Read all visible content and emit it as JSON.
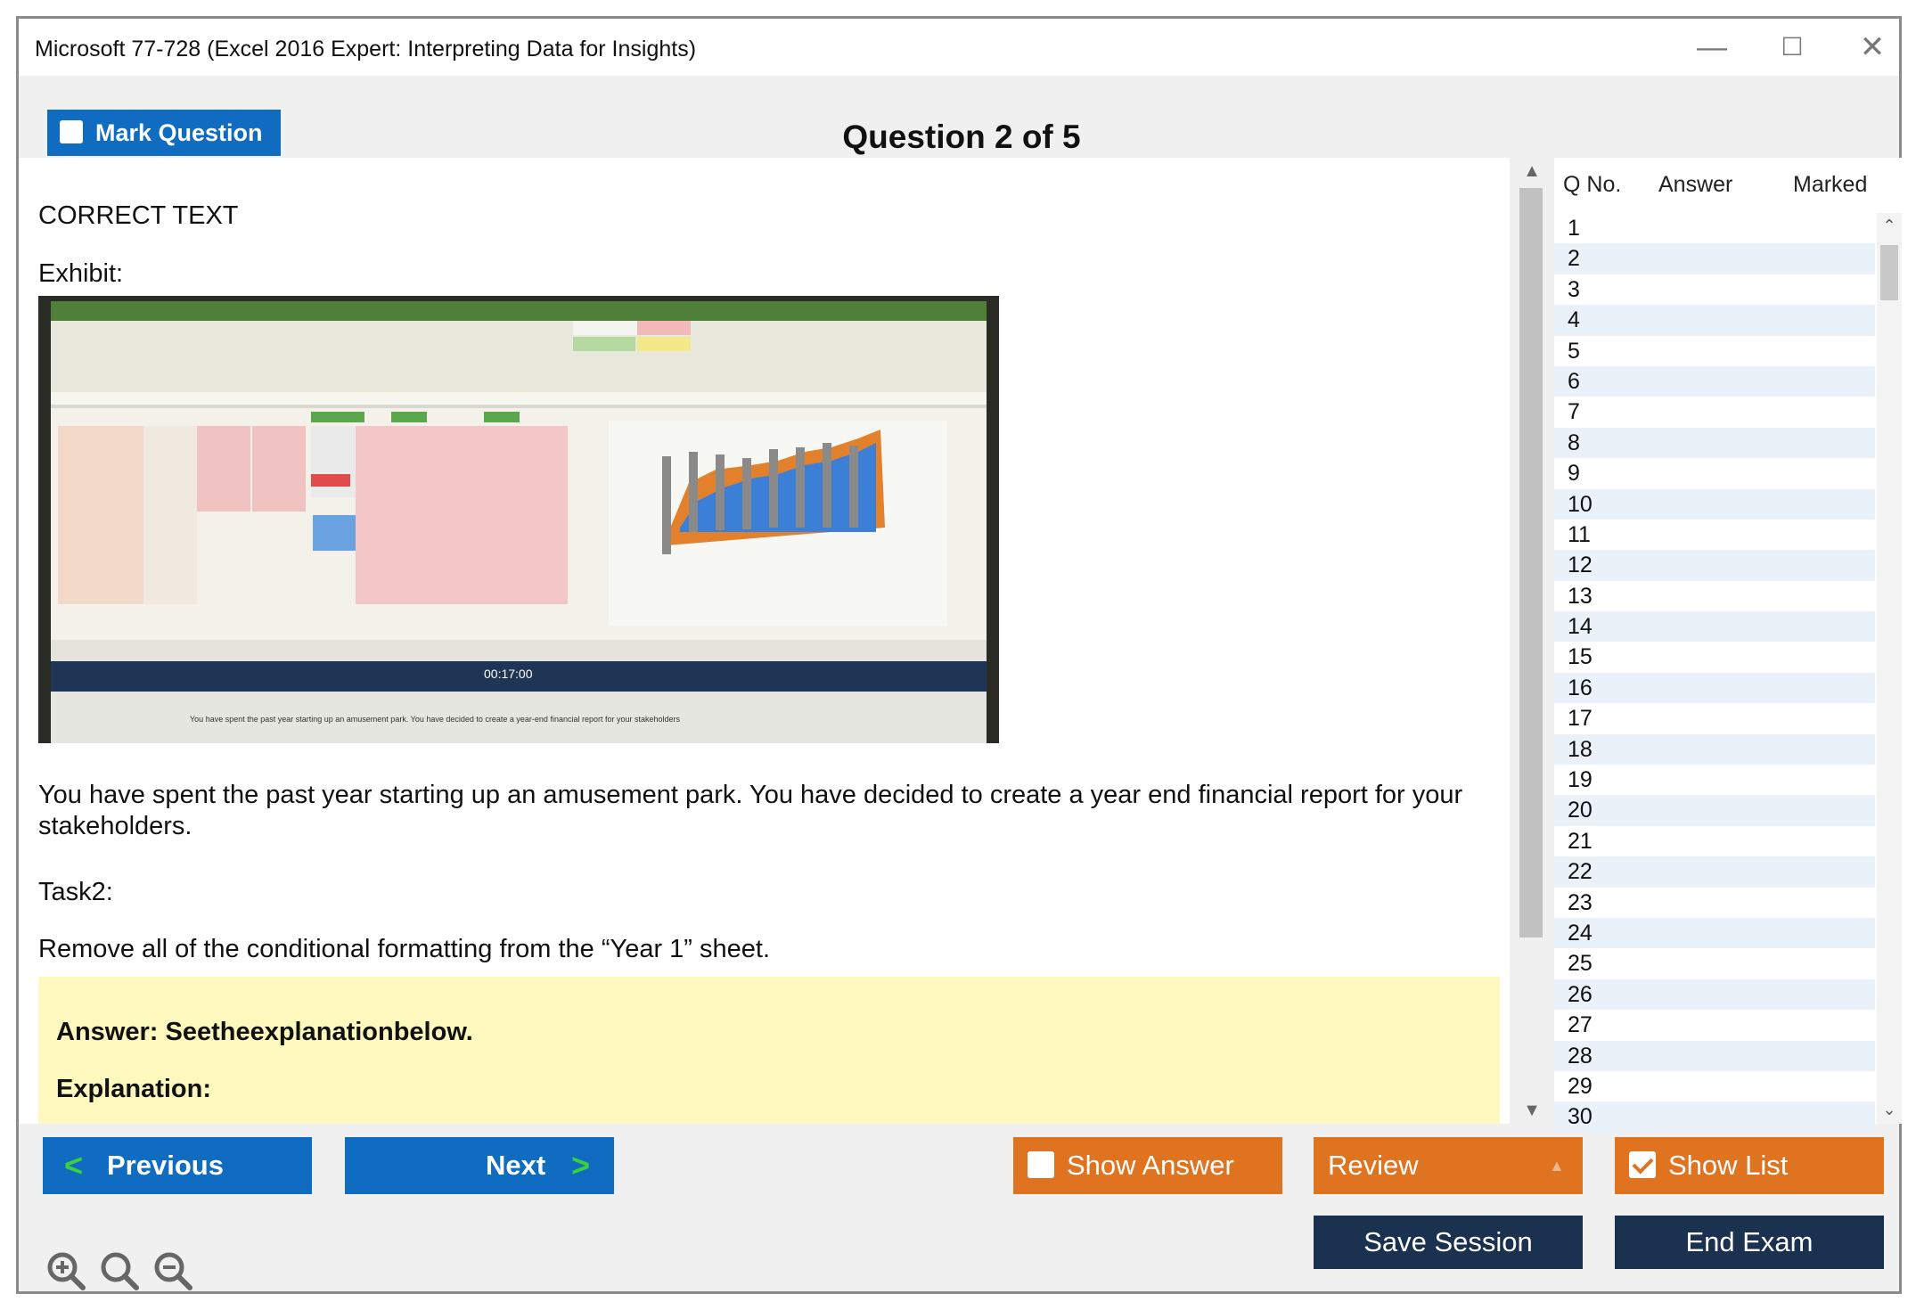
{
  "window": {
    "title": "Microsoft 77-728 (Excel 2016 Expert: Interpreting Data for Insights)",
    "controls": {
      "minimize": "—",
      "maximize": "☐",
      "close": "✕"
    }
  },
  "header": {
    "mark_label": "Mark Question",
    "question_title": "Question 2 of 5"
  },
  "content": {
    "section_label": "CORRECT TEXT",
    "exhibit_label": "Exhibit:",
    "exhibit_timer": "00:17:00",
    "exhibit_caption": "You have spent the past year starting up an amusement park. You have decided to create a year-end financial report for your stakeholders",
    "scenario": "You have spent the past year starting up an amusement park. You have decided to create a year end financial report for your stakeholders.",
    "task_label": "Task2:",
    "task_text": "Remove all of the conditional formatting from the “Year 1” sheet.",
    "answer": "Answer: Seetheexplanationbelow.",
    "explanation_label": "Explanation:"
  },
  "question_list": {
    "headers": {
      "number": "Q No.",
      "answer": "Answer",
      "marked": "Marked"
    },
    "rows": [
      "1",
      "2",
      "3",
      "4",
      "5",
      "6",
      "7",
      "8",
      "9",
      "10",
      "11",
      "12",
      "13",
      "14",
      "15",
      "16",
      "17",
      "18",
      "19",
      "20",
      "21",
      "22",
      "23",
      "24",
      "25",
      "26",
      "27",
      "28",
      "29",
      "30"
    ]
  },
  "footer": {
    "previous_label": "Previous",
    "next_label": "Next",
    "show_answer_label": "Show Answer",
    "review_label": "Review",
    "show_list_label": "Show List",
    "show_list_checked": true,
    "save_session_label": "Save Session",
    "end_exam_label": "End Exam"
  },
  "icons": [
    "zoom-in-icon",
    "zoom-reset-icon",
    "zoom-out-icon"
  ],
  "colors": {
    "accent_blue": "#0f6cc1",
    "accent_orange": "#e0731f",
    "navy": "#1b3150",
    "answer_bg": "#fdf8be",
    "chevron_green": "#3ad13a"
  }
}
